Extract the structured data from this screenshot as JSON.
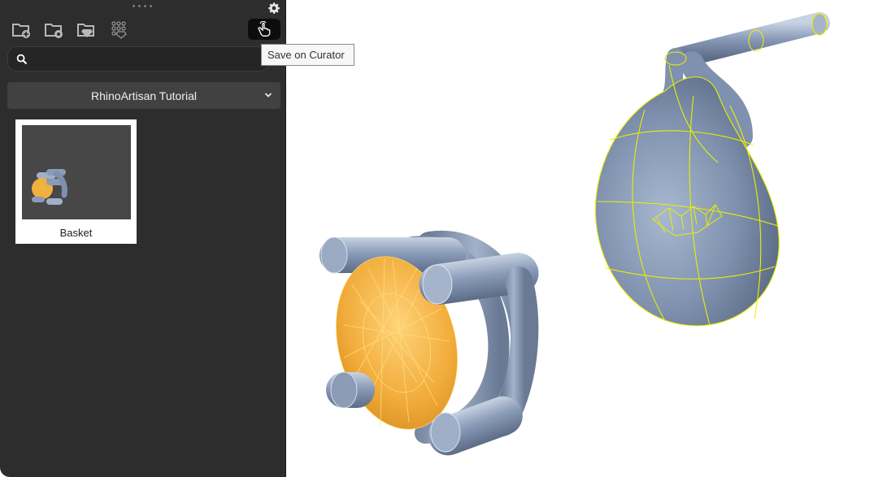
{
  "panel": {
    "toolbar": {
      "icons": [
        "new-folder-icon",
        "folder-settings-icon",
        "save-gem-icon",
        "gem-grid-icon"
      ],
      "curator_button_icon": "hand-pointer-icon"
    },
    "search": {
      "value": "",
      "placeholder": ""
    },
    "dropdown": {
      "selected": "RhinoArtisan Tutorial"
    },
    "cards": [
      {
        "label": "Basket"
      }
    ]
  },
  "tooltip": {
    "text": "Save on Curator"
  },
  "colors": {
    "panel_bg": "#2d2d2d",
    "metal": "#8a9bb8",
    "gem": "#f2ae3e",
    "selection": "#e8f000"
  }
}
